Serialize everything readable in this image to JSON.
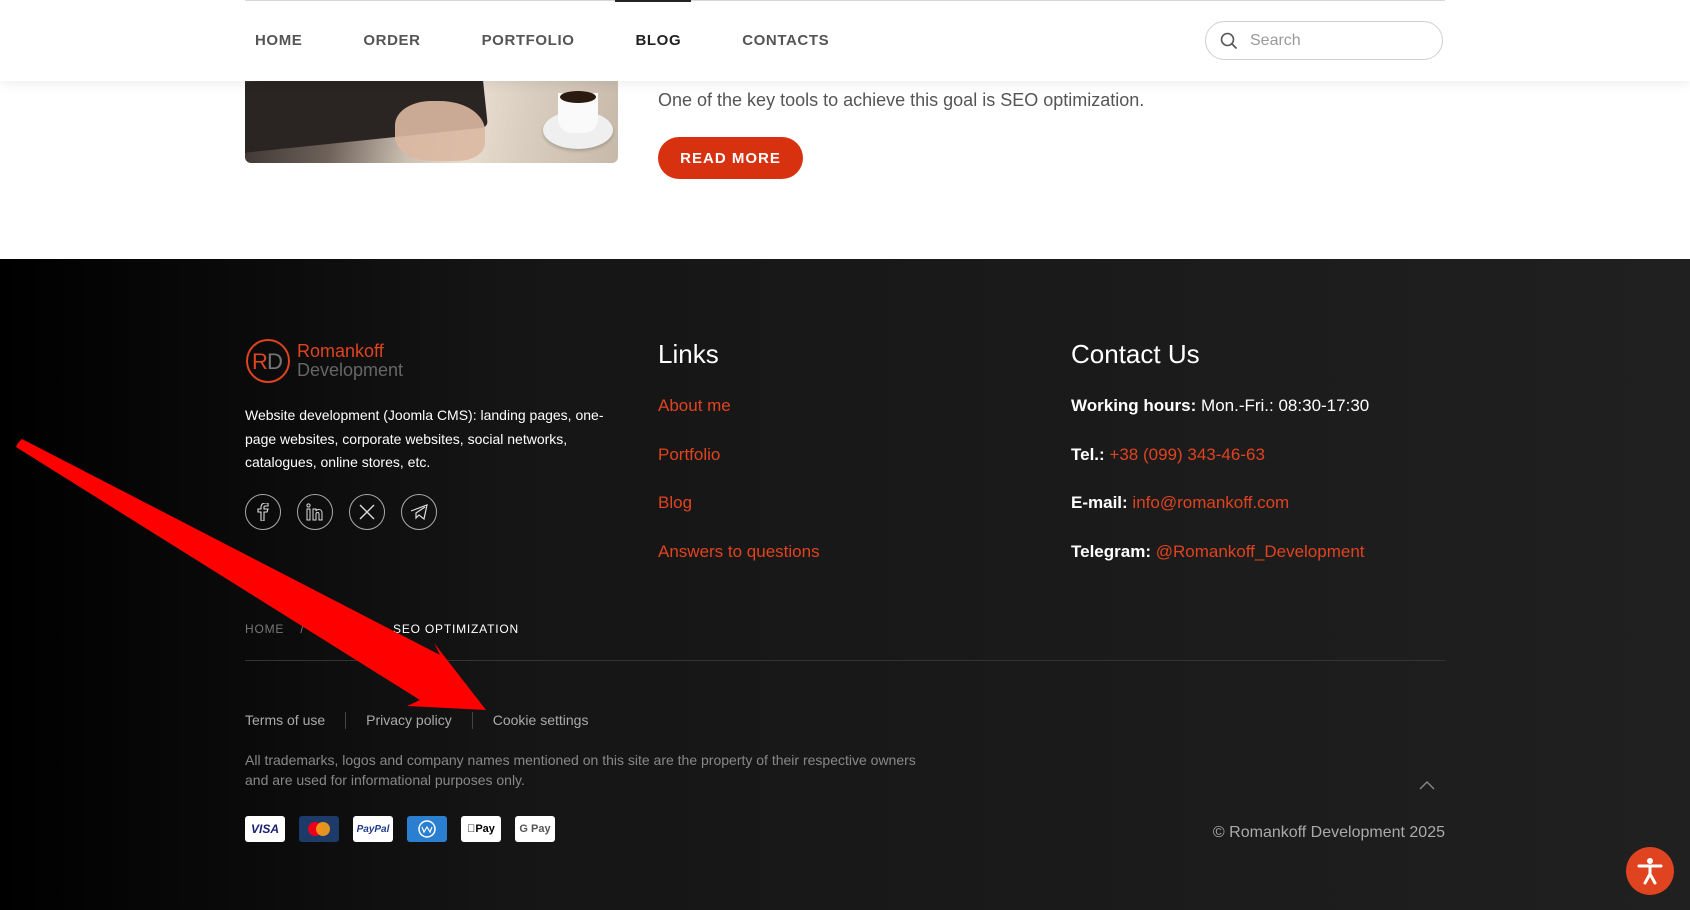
{
  "header": {
    "nav": [
      "HOME",
      "ORDER",
      "PORTFOLIO",
      "BLOG",
      "CONTACTS"
    ],
    "active_nav": "BLOG",
    "search": {
      "placeholder": "Search"
    }
  },
  "article": {
    "excerpt": "One of the key tools to achieve this goal is SEO optimization.",
    "read_more": "READ MORE"
  },
  "footer": {
    "logo": {
      "line1": "Romankoff",
      "line2": "Development"
    },
    "about": "Website development (Joomla CMS): landing pages, one-page websites, corporate websites, social networks, catalogues, online stores, etc.",
    "socials": [
      "facebook-icon",
      "linkedin-icon",
      "x-icon",
      "telegram-icon"
    ],
    "links_title": "Links",
    "links": [
      "About me",
      "Portfolio",
      "Blog",
      "Answers to questions"
    ],
    "contacts_title": "Contact Us",
    "contacts": {
      "hours_label": "Working hours:",
      "hours_value": "Mon.-Fri.: 08:30-17:30",
      "tel_label": "Tel.:",
      "tel_value": "+38 (099) 343-46-63",
      "email_label": "E-mail:",
      "email_value": "info@romankoff.com",
      "telegram_label": "Telegram:",
      "telegram_value": "@Romankoff_Development"
    },
    "breadcrumbs": {
      "home": "HOME",
      "middle": "BLOG",
      "current": "SEO OPTIMIZATION"
    },
    "legal": {
      "terms": "Terms of use",
      "privacy": "Privacy policy",
      "cookies": "Cookie settings"
    },
    "disclaimer": "All trademarks, logos and company names mentioned on this site are the property of their respective owners and are used for informational purposes only.",
    "payments": {
      "visa": "VISA",
      "paypal": "PayPal",
      "webmoney": "WebMoney",
      "applepay": "Pay",
      "gpay": "G Pay"
    },
    "copyright": "© Romankoff Development 2025"
  },
  "colors": {
    "accent": "#e0431f",
    "button": "#d8310f",
    "annotation_arrow": "#ff0000"
  }
}
